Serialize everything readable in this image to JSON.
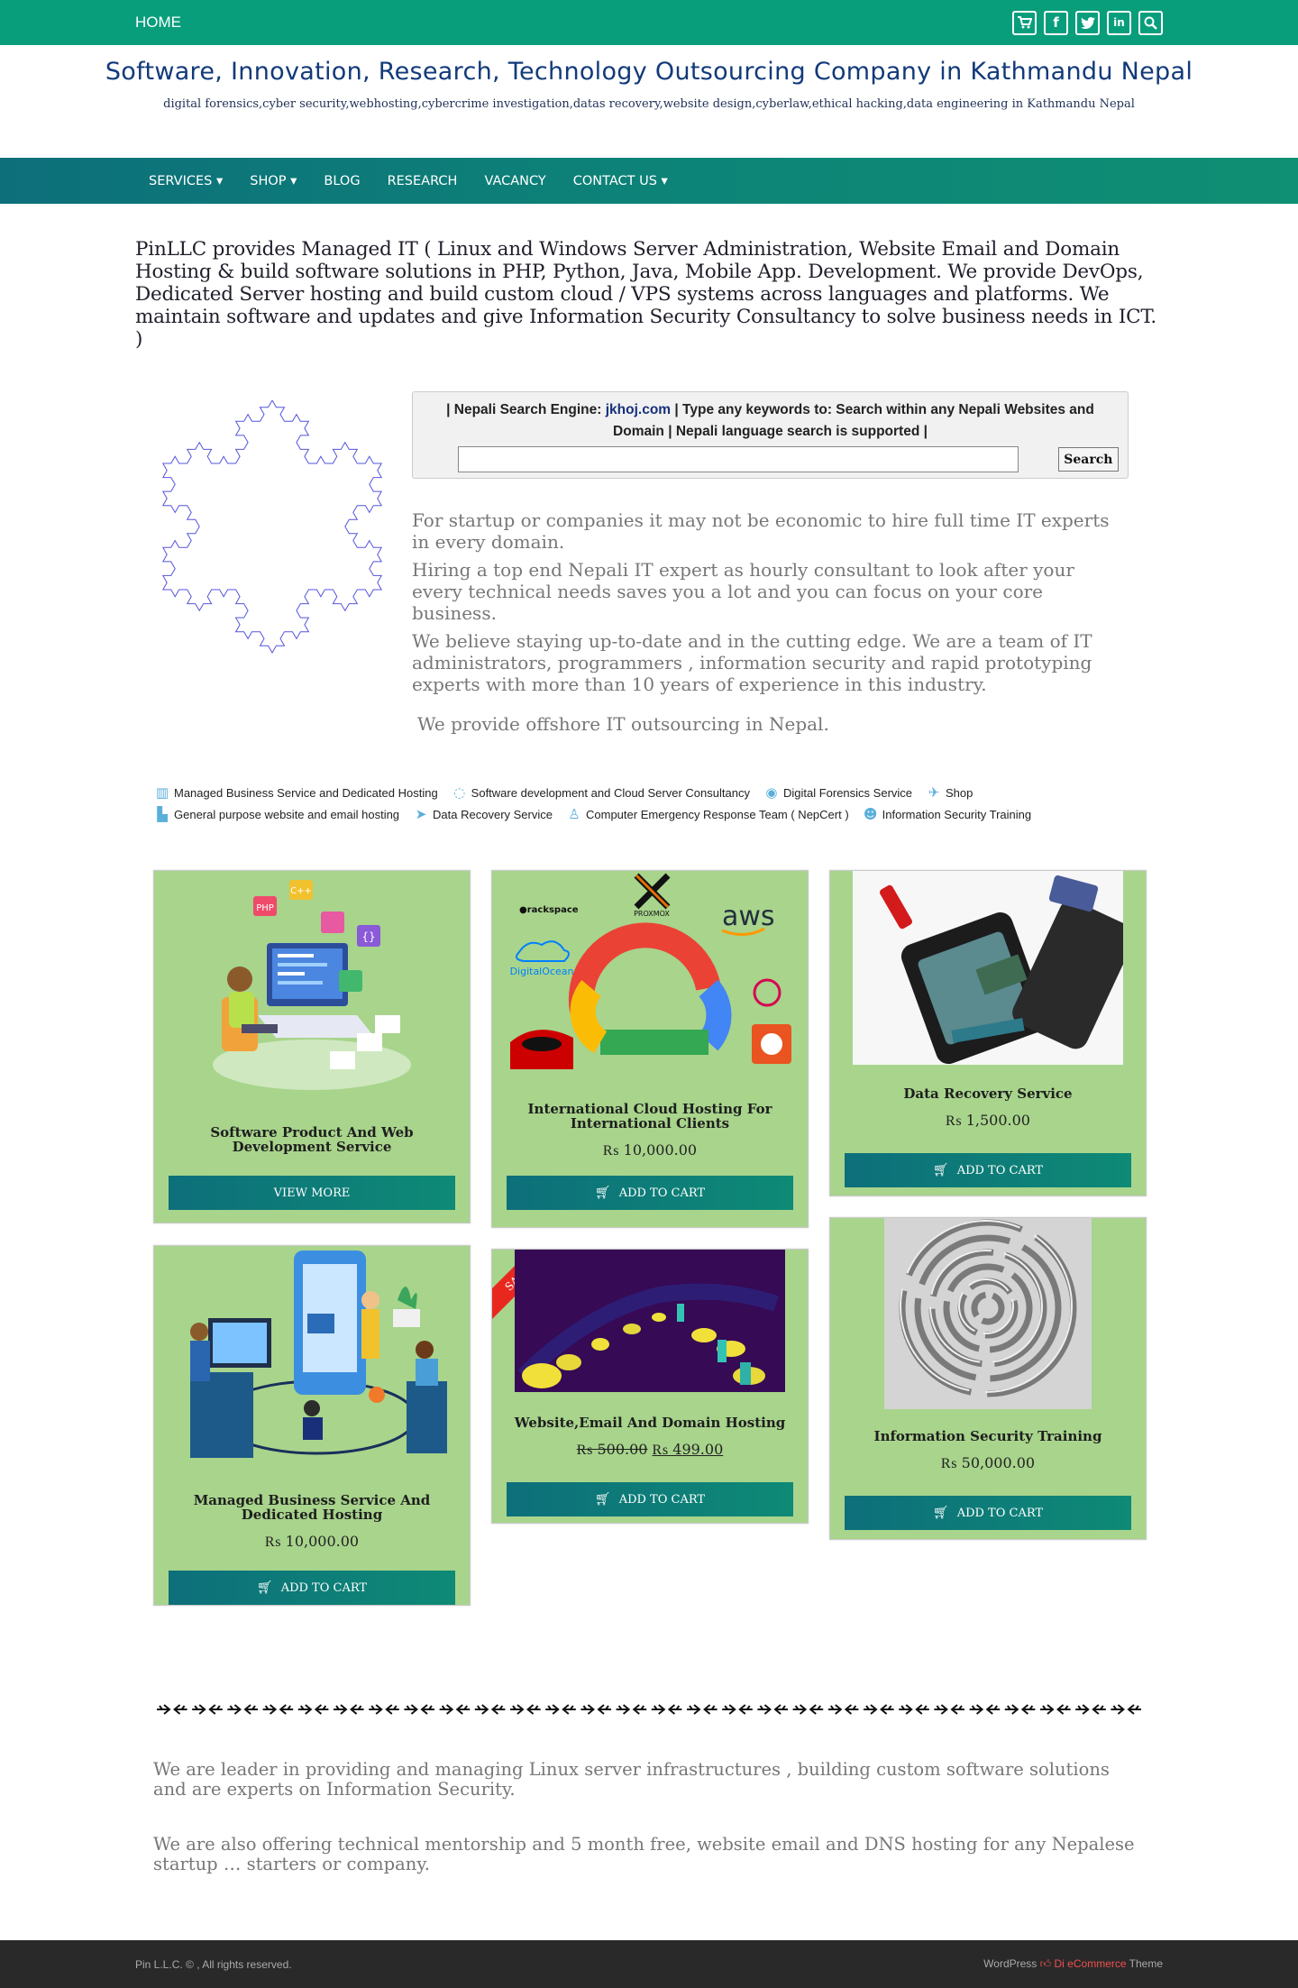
{
  "topbar": {
    "home_label": "HOME",
    "icons": [
      "cart-icon",
      "facebook-icon",
      "twitter-icon",
      "linkedin-icon",
      "search-icon"
    ]
  },
  "header": {
    "title": "Software, Innovation, Research, Technology Outsourcing Company in Kathmandu Nepal",
    "description": "digital forensics,cyber security,webhosting,cybercrime investigation,datas recovery,website design,cyberlaw,ethical hacking,data engineering in Kathmandu Nepal"
  },
  "nav": {
    "items": [
      "SERVICES ▾",
      "SHOP ▾",
      "BLOG",
      "RESEARCH",
      "VACANCY",
      "CONTACT US ▾"
    ]
  },
  "intro": {
    "text": "PinLLC provides Managed IT ( Linux and Windows Server Administration, Website Email and Domain Hosting & build software solutions in PHP, Python, Java, Mobile App. Development. We provide DevOps, Dedicated Server hosting and build custom cloud / VPS systems across languages and platforms. We maintain software and updates and give Information Security Consultancy to solve business needs in ICT. )"
  },
  "search": {
    "prefix": "| Nepali Search Engine: ",
    "link": "jkhoj.com",
    "suffix": " | Type any keywords to: Search within any Nepali Websites and Domain | Nepali language search is supported |",
    "button": "Search"
  },
  "pitch": {
    "p1": "For startup or companies it may not be economic to hire full time IT experts in every domain.",
    "p2": "Hiring a top end Nepali IT expert as hourly consultant to look after your every technical needs saves you a lot and you can focus on your core business.",
    "p3": "We believe staying up-to-date and in the cutting edge. We are a team of IT administrators,  programmers , information security and rapid prototyping experts with more than 10 years of experience in this industry.",
    "p4": "We provide offshore IT outsourcing in Nepal."
  },
  "services": {
    "row1": [
      {
        "label": "Managed Business Service and Dedicated Hosting",
        "icon": "building-icon"
      },
      {
        "label": "Software development and Cloud Server Consultancy",
        "icon": "spinner-icon"
      },
      {
        "label": "Digital Forensics Service",
        "icon": "eye-icon"
      },
      {
        "label": "Shop",
        "icon": "plane-icon"
      }
    ],
    "row2": [
      {
        "label": "General purpose website and email hosting",
        "icon": "server-icon"
      },
      {
        "label": "Data Recovery Service",
        "icon": "fighter-jet-icon"
      },
      {
        "label": "Computer Emergency Response Team ( NepCert )",
        "icon": "person-icon"
      },
      {
        "label": "Information Security Training",
        "icon": "users-icon"
      }
    ]
  },
  "products": [
    {
      "title": "Software Product And Web Development Service",
      "price": "",
      "button": "VIEW MORE",
      "image": "developer-illustration"
    },
    {
      "title": "International Cloud Hosting For International Clients",
      "price": "₨ 10,000.00",
      "button": "ADD TO CART",
      "image": "cloud-logos"
    },
    {
      "title": "Data Recovery Service",
      "price": "₨ 1,500.00",
      "button": "ADD TO CART",
      "image": "phone-repair-photo"
    },
    {
      "title": "Managed Business Service And Dedicated Hosting",
      "price": "₨ 10,000.00",
      "button": "ADD TO CART",
      "image": "business-illustration"
    },
    {
      "title": "Website,Email And Domain Hosting",
      "price_old": "₨ 500.00",
      "price_new": "₨ 499.00",
      "sale": "SALE!",
      "button": "ADD TO CART",
      "image": "traffic-heatmap"
    },
    {
      "title": "Information Security Training",
      "price": "₨ 50,000.00",
      "button": "ADD TO CART",
      "image": "maze-photo"
    }
  ],
  "outro": {
    "p1": " We are leader in providing and managing Linux server infrastructures , building custom software solutions and are experts on Information Security.",
    "p2": "We are also offering technical mentorship and 5 month free, website email and DNS hosting for any Nepalese startup …  starters or company."
  },
  "footer": {
    "copyright": "Pin L.L.C. © , All rights reserved.",
    "theme_prefix": "WordPress ",
    "theme_brand": "Di eCommerce",
    "theme_suffix": " Theme"
  },
  "colors": {
    "topbar": "#089e7c",
    "nav": "#0d8378",
    "card_bg": "#a8d48c",
    "button": "#0d6f7a",
    "title": "#123a7a",
    "footer": "#292929"
  }
}
